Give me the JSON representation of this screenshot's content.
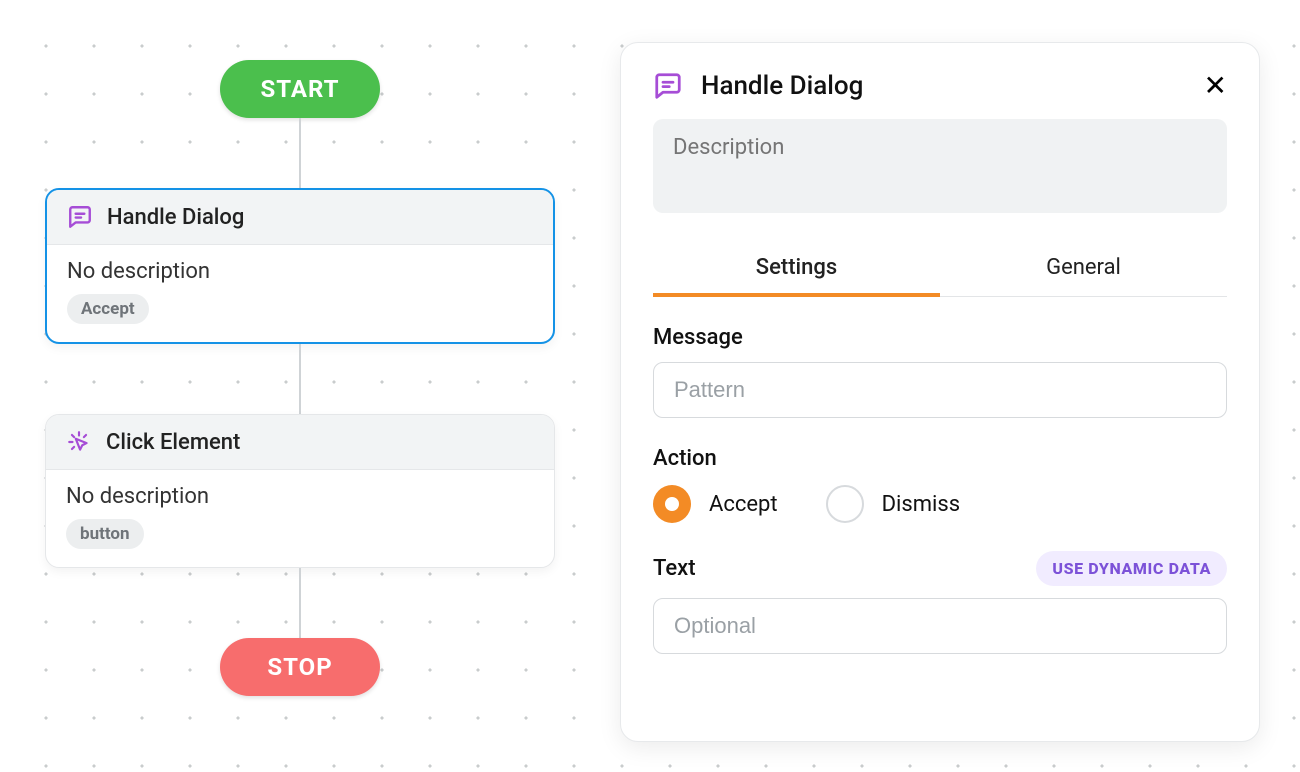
{
  "flow": {
    "start_label": "START",
    "stop_label": "STOP",
    "nodes": [
      {
        "kind": "handle-dialog",
        "title": "Handle Dialog",
        "description": "No description",
        "tag": "Accept",
        "selected": true
      },
      {
        "kind": "click-element",
        "title": "Click Element",
        "description": "No description",
        "tag": "button",
        "selected": false
      }
    ]
  },
  "panel": {
    "title": "Handle Dialog",
    "description_placeholder": "Description",
    "tabs": {
      "settings": "Settings",
      "general": "General",
      "active": "settings"
    },
    "message": {
      "label": "Message",
      "placeholder": "Pattern",
      "value": ""
    },
    "action": {
      "label": "Action",
      "options": [
        {
          "id": "accept",
          "label": "Accept",
          "checked": true
        },
        {
          "id": "dismiss",
          "label": "Dismiss",
          "checked": false
        }
      ]
    },
    "text": {
      "label": "Text",
      "placeholder": "Optional",
      "value": "",
      "dynamic_button": "USE DYNAMIC DATA"
    }
  },
  "colors": {
    "accent": "#f38b25",
    "select": "#1492e6",
    "start": "#4bbf4d",
    "stop": "#f76d6d",
    "purple": "#a64dd6"
  }
}
